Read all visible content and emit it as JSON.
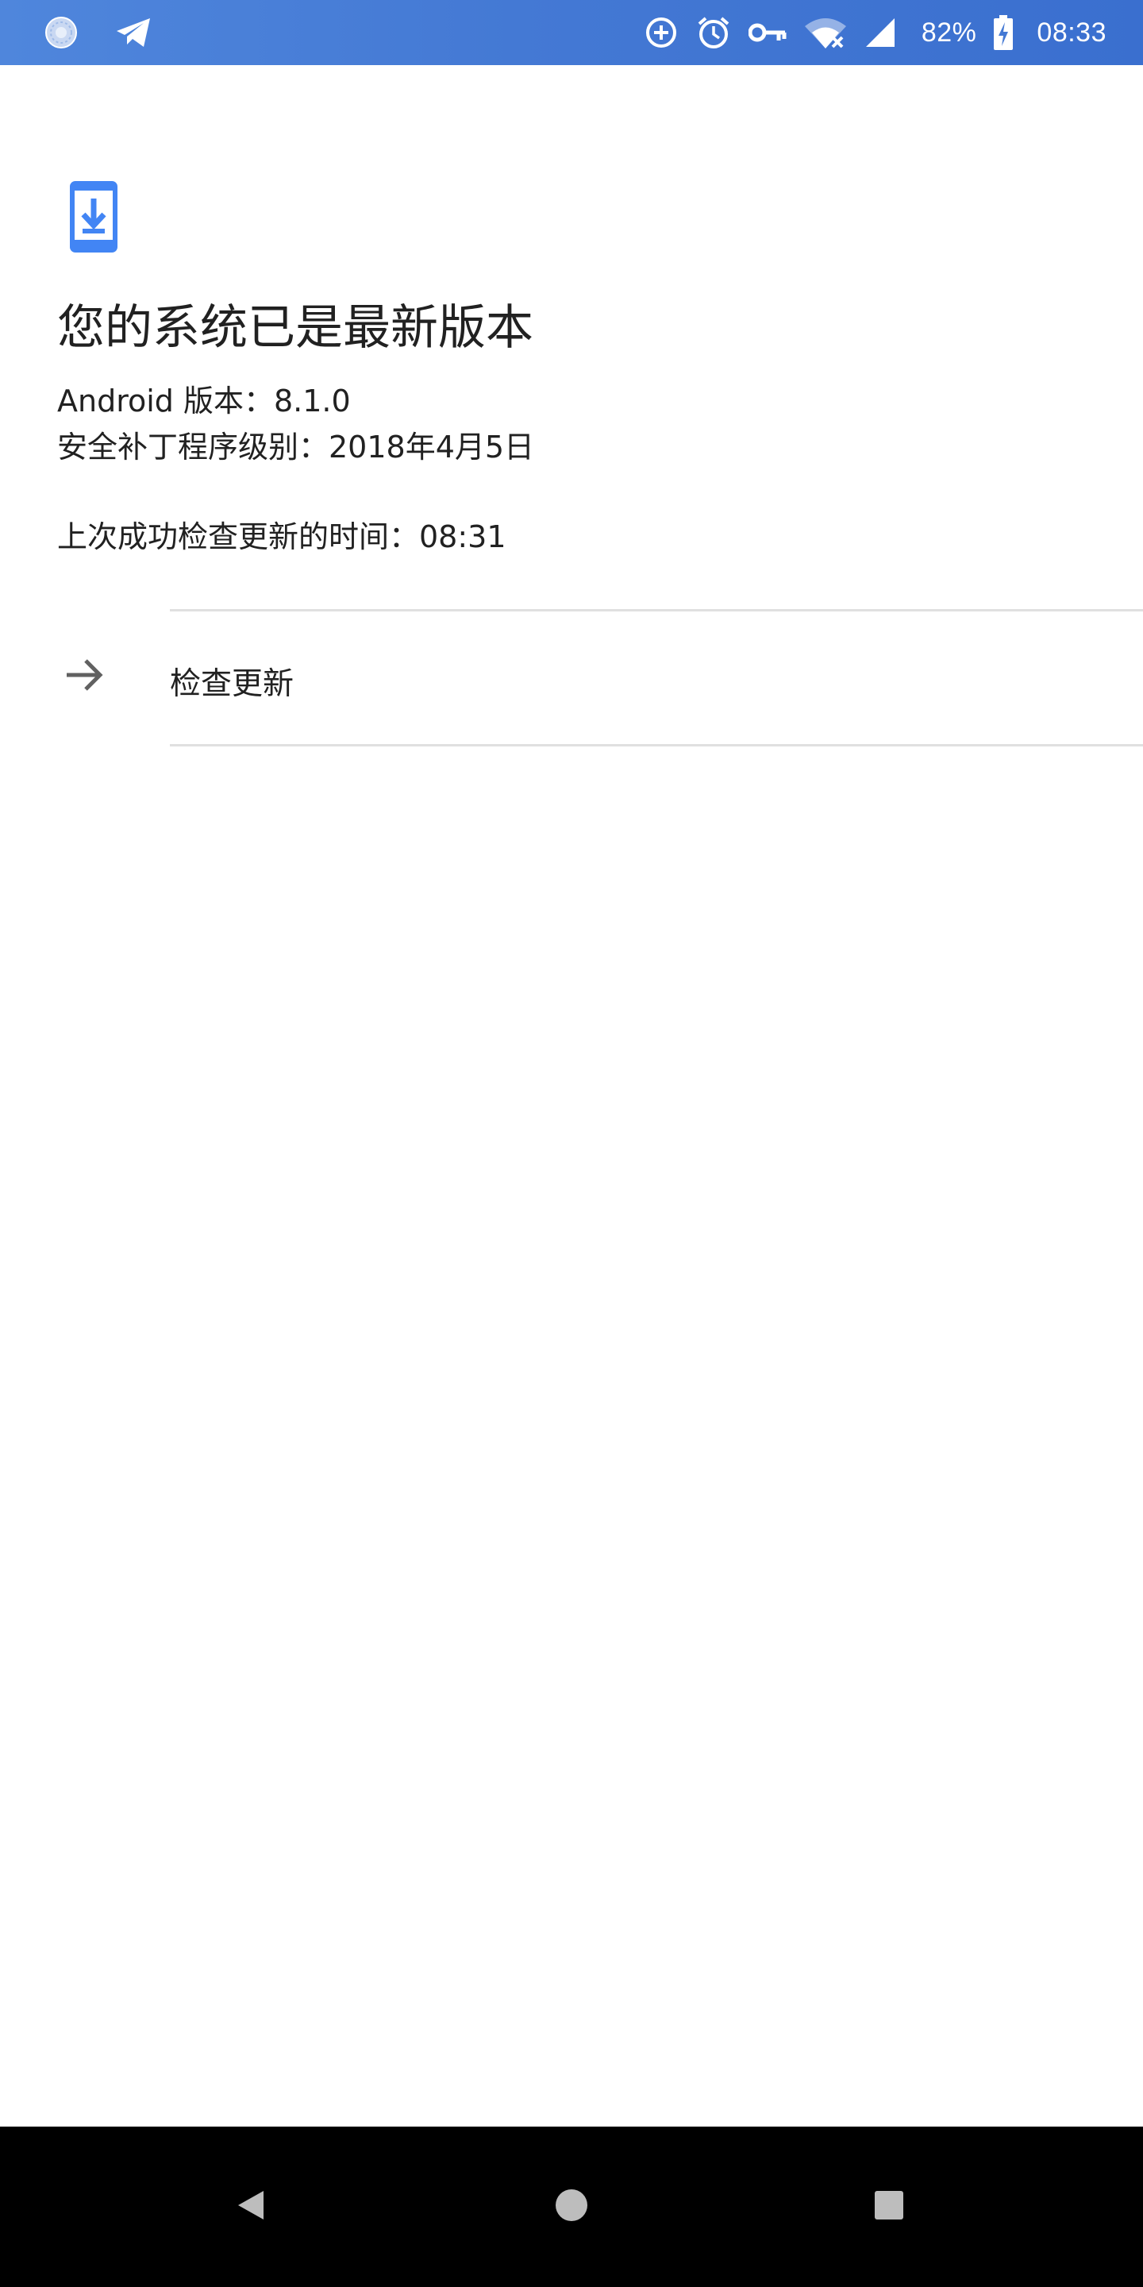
{
  "status_bar": {
    "left_icons": [
      "system-update-icon",
      "telegram-icon"
    ],
    "right_icons": [
      "data-saver-icon",
      "alarm-icon",
      "vpn-key-icon",
      "wifi-no-internet-icon",
      "cell-signal-icon",
      "battery-charging-icon"
    ],
    "battery_percent": "82%",
    "time": "08:33",
    "background_color": "#4479d4"
  },
  "main": {
    "icon": "phone-download-icon",
    "accent_color": "#4285f4",
    "title": "您的系统已是最新版本",
    "android_version": "Android 版本：8.1.0",
    "security_patch": "安全补丁程序级别：2018年4月5日",
    "last_check": "上次成功检查更新的时间：08:31"
  },
  "action": {
    "icon": "arrow-forward-icon",
    "label": "检查更新"
  },
  "nav_bar": {
    "buttons": [
      "back-icon",
      "home-icon",
      "recents-icon"
    ]
  }
}
